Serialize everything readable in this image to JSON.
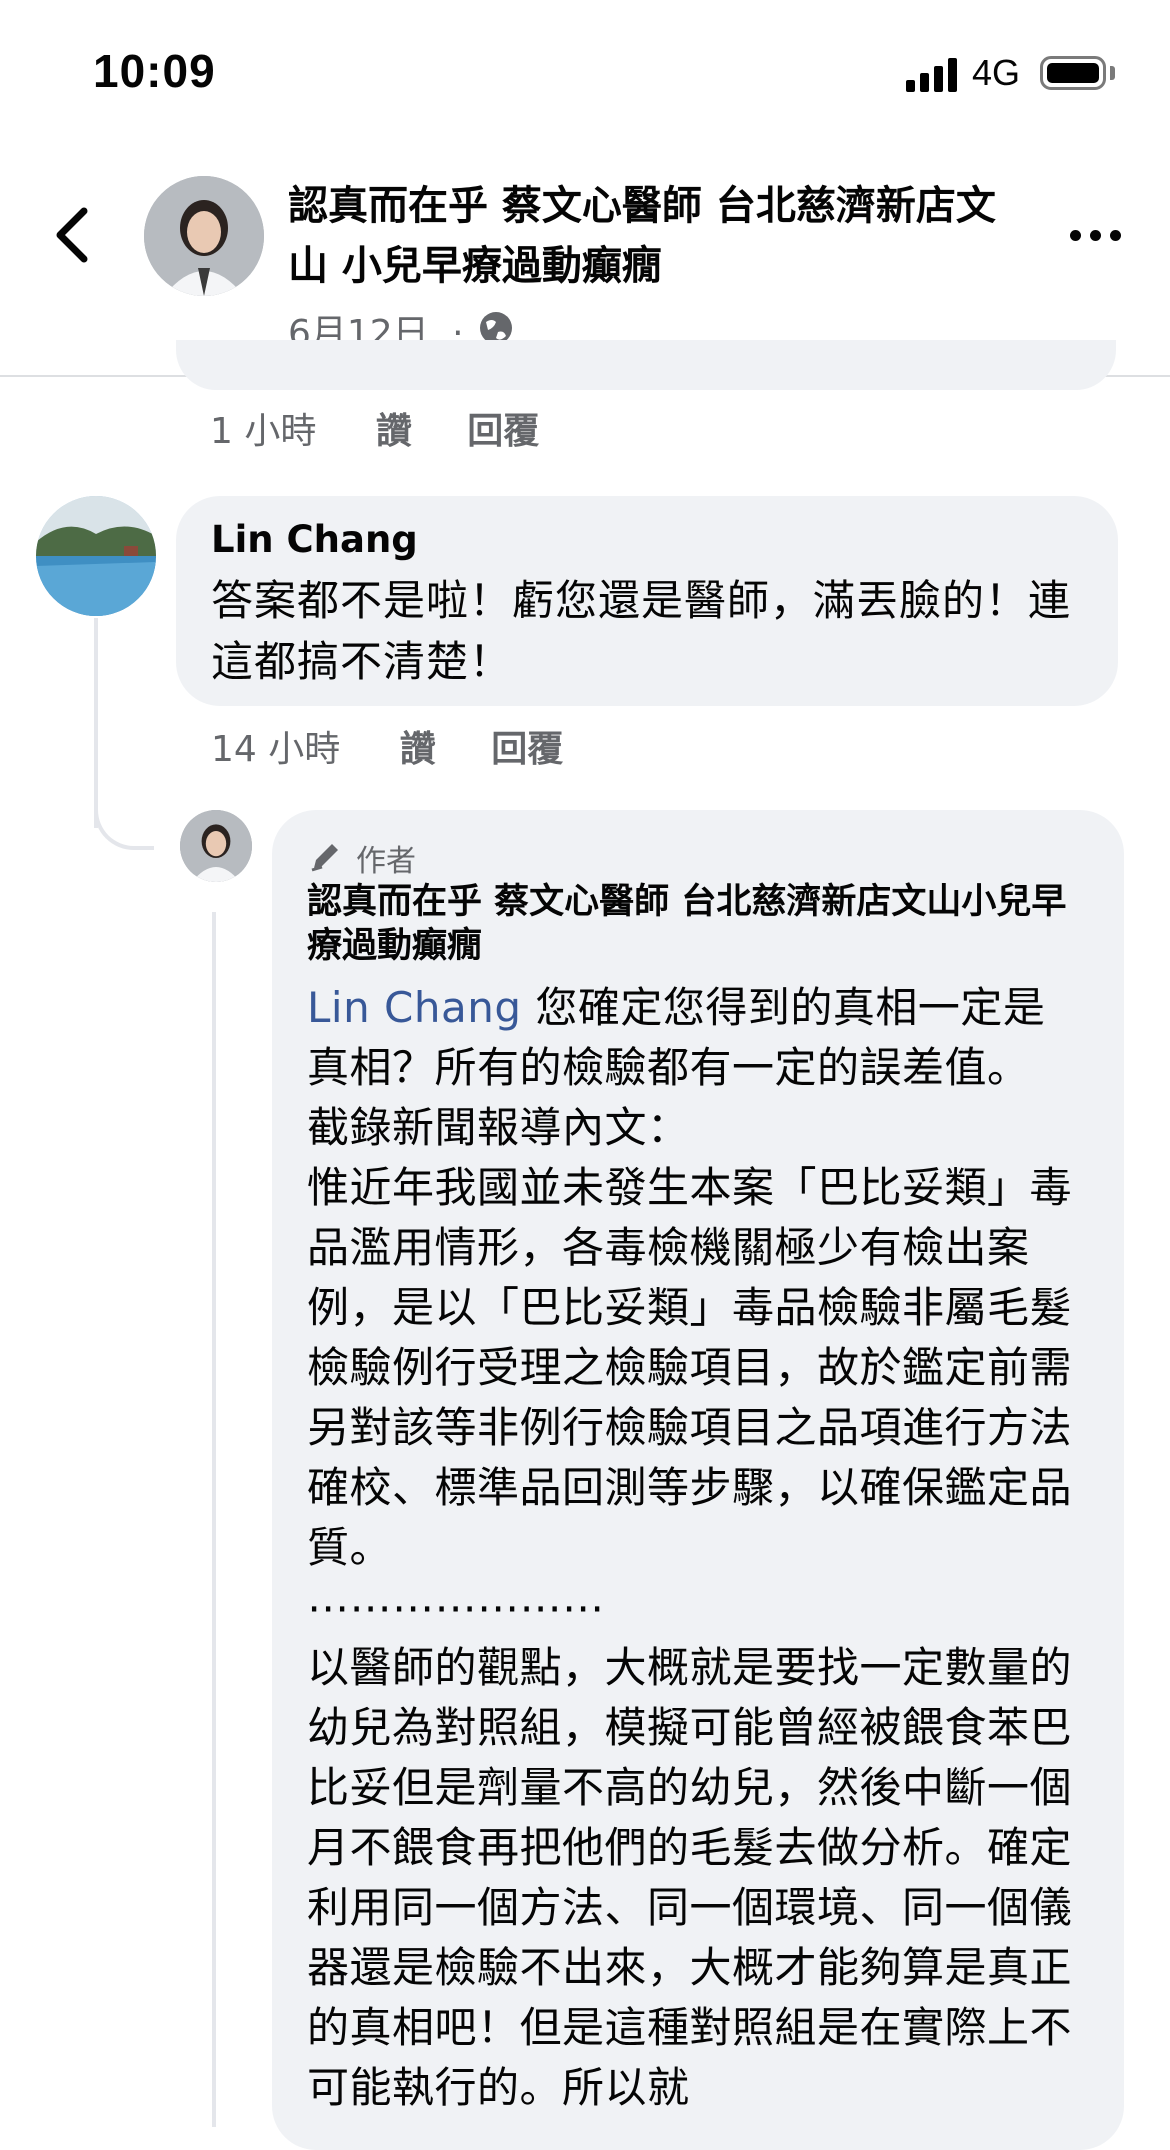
{
  "status_bar": {
    "time": "10:09",
    "network": "4G"
  },
  "header": {
    "title": "認真而在乎 蔡文心醫師  台北慈濟新店文山 小兒早療過動癲癇",
    "date": "6月12日",
    "separator": "·"
  },
  "previous_comment": {
    "time": "1 小時",
    "like": "讚",
    "reply": "回覆"
  },
  "comment": {
    "author": "Lin Chang",
    "text": "答案都不是啦！虧您還是醫師，滿丟臉的！連這都搞不清楚！",
    "time": "14 小時",
    "like": "讚",
    "reply": "回覆"
  },
  "reply": {
    "badge": "作者",
    "author": "認真而在乎 蔡文心醫師  台北慈濟新店文山小兒早療過動癲癇",
    "mention": "Lin Chang",
    "body": " 您確定您得到的真相一定是真相？所有的檢驗都有一定的誤差值。\n截錄新聞報導內文：\n惟近年我國並未發生本案「巴比妥類」毒品濫用情形，各毒檢機關極少有檢出案例，是以「巴比妥類」毒品檢驗非屬毛髮檢驗例行受理之檢驗項目，故於鑑定前需另對該等非例行檢驗項目之品項進行方法確校、標準品回測等步驟，以確保鑑定品質。\n⋯⋯⋯⋯⋯⋯⋯\n以醫師的觀點，大概就是要找一定數量的幼兒為對照組，模擬可能曾經被餵食苯巴比妥但是劑量不高的幼兒，然後中斷一個月不餵食再把他們的毛髮去做分析。確定利用同一個方法、同一個環境、同一個儀器還是檢驗不出來，大概才能夠算是真正的真相吧！但是這種對照組是在實際上不可能執行的。所以就"
  },
  "icons": [
    "back-arrow-icon",
    "globe-icon",
    "more-icon",
    "pencil-icon",
    "signal-icon",
    "battery-icon"
  ],
  "colors": {
    "bubble": "#f0f2f5",
    "mention": "#385898",
    "meta": "#65676b"
  }
}
